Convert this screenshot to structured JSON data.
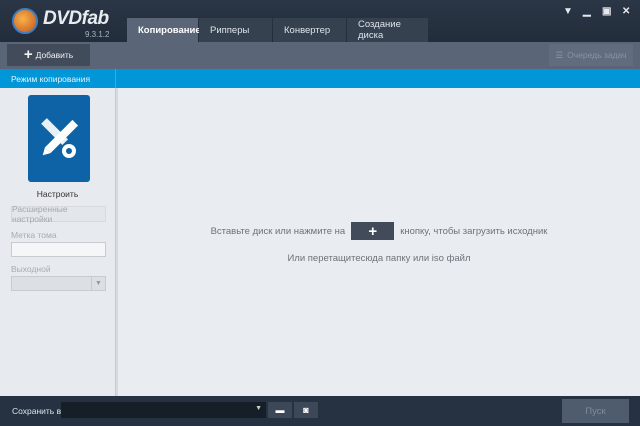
{
  "app": {
    "brand": "DVDfab",
    "version": "9.3.1.2"
  },
  "tabs": [
    {
      "label": "Копирование",
      "active": true
    },
    {
      "label": "Рипперы"
    },
    {
      "label": "Конвертер"
    },
    {
      "label": "Создание диска"
    }
  ],
  "window_controls": [
    "menu-dropdown",
    "minimize",
    "maximize",
    "close"
  ],
  "toolbar": {
    "add_label": "Добавить",
    "queue_label": "Очередь задач"
  },
  "mode_bar": {
    "label": "Режим копирования"
  },
  "sidebar": {
    "configure_label": "Настроить",
    "advanced_label": "Расширенные настройки",
    "volume_label": "Метка тома",
    "volume_value": "",
    "output_label": "Выходной",
    "output_value": ""
  },
  "main": {
    "hint_before": "Вставьте диск или нажмите на",
    "hint_after": "кнопку, чтобы загрузить исходник",
    "hint_drag": "Или перетащитесюда папку или iso файл"
  },
  "bottom": {
    "save_label": "Сохранить в:",
    "save_path": "",
    "start_label": "Пуск"
  },
  "colors": {
    "accent": "#0096d8",
    "title_bg": "#252f3d",
    "toolbar": "#5a6678",
    "card": "#0d63a6"
  }
}
